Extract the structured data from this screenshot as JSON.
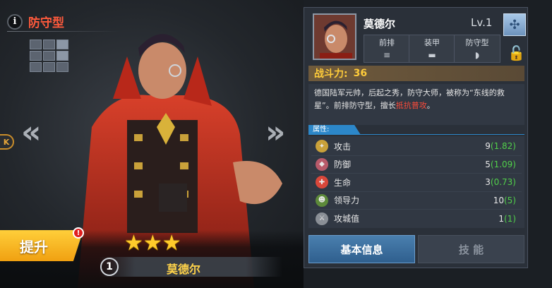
{
  "stage": {
    "type_label": "防守型",
    "info_icon": "i",
    "k_label": "K",
    "arrow_left": "«",
    "arrow_right": "»",
    "upgrade_label": "提升",
    "upgrade_badge": "!",
    "stars": "★★★",
    "star_count": 3,
    "rank": "1",
    "hero_name": "莫德尔"
  },
  "panel": {
    "name": "莫德尔",
    "level": "Lv.1",
    "dna_icon": "dna-icon",
    "tags": [
      {
        "label": "前排",
        "icon": "row-icon"
      },
      {
        "label": "装甲",
        "icon": "tank-icon"
      },
      {
        "label": "防守型",
        "icon": "shield-icon"
      }
    ],
    "power_label": "战斗力:",
    "power_value": "36",
    "description_main": "德国陆军元帅，后起之秀，防守大师，被称为“东线的救星”。前排防守型，擅长",
    "description_highlight": "抵抗普攻",
    "description_end": "。",
    "attr_tab": "属性:",
    "attributes": [
      {
        "name": "攻击",
        "value": "9",
        "growth": "(1.82)",
        "icon": "attack-icon",
        "color": "#c9a13a"
      },
      {
        "name": "防御",
        "value": "5",
        "growth": "(1.09)",
        "icon": "defense-icon",
        "color": "#b85a6a"
      },
      {
        "name": "生命",
        "value": "3",
        "growth": "(0.73)",
        "icon": "health-icon",
        "color": "#d9473a"
      },
      {
        "name": "领导力",
        "value": "10",
        "growth": "(5)",
        "icon": "leadership-icon",
        "color": "#5d8a3a"
      },
      {
        "name": "攻城值",
        "value": "1",
        "growth": "(1)",
        "icon": "siege-icon",
        "color": "#8a8f96"
      }
    ],
    "tabs": [
      {
        "label": "基本信息",
        "active": true
      },
      {
        "label": "技 能",
        "active": false
      }
    ]
  }
}
